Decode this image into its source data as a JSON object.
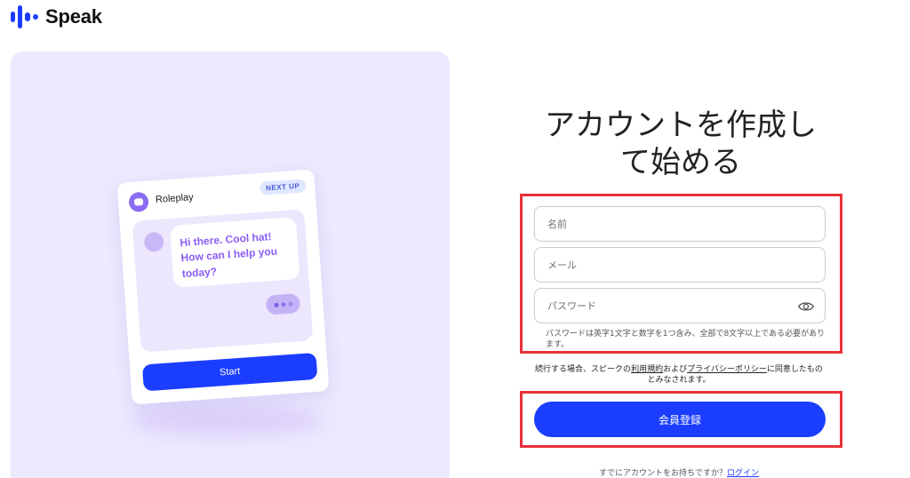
{
  "brand": {
    "name": "Speak",
    "color": "#1b3dff"
  },
  "preview_card": {
    "title": "Roleplay",
    "badge": "NEXT UP",
    "message": "Hi there. Cool hat! How can I help you today?",
    "start_label": "Start",
    "avatar_icon": "robot-icon"
  },
  "signup": {
    "heading_line1": "アカウントを作成し",
    "heading_line2": "て始める",
    "name_placeholder": "名前",
    "email_placeholder": "メール",
    "password_placeholder": "パスワード",
    "password_hint": "パスワードは英字1文字と数字を1つ含み、全部で8文字以上である必要があります。",
    "terms_before": "続行する場合、スピークの",
    "terms_link": "利用規約",
    "terms_middle": "および",
    "privacy_link": "プライバシーポリシー",
    "terms_after": "に同意したものとみなされます。",
    "submit_label": "会員登録",
    "login_prompt": "すでにアカウントをお持ちですか？",
    "login_link": "ログイン"
  },
  "colors": {
    "accent": "#1b3dff",
    "highlight_border": "#e8303a",
    "panel_bg": "#ede9fe",
    "chat_text": "#8b5cf6"
  }
}
